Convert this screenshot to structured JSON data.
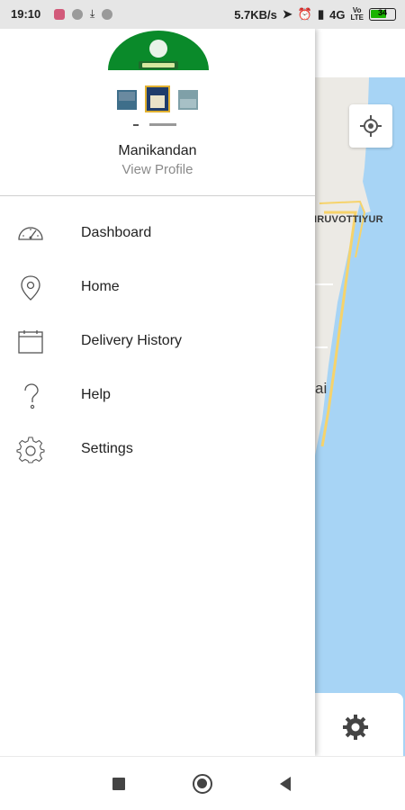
{
  "status_bar": {
    "time": "19:10",
    "network_speed": "5.7KB/s",
    "network_type": "4G",
    "lte_top": "Vo",
    "lte_bottom": "LTE",
    "battery": "34"
  },
  "drawer": {
    "user_name": "Manikandan",
    "view_profile": "View Profile",
    "menu": [
      {
        "label": "Dashboard",
        "icon": "speedometer-icon"
      },
      {
        "label": "Home",
        "icon": "location-pin-icon"
      },
      {
        "label": "Delivery History",
        "icon": "calendar-icon"
      },
      {
        "label": "Help",
        "icon": "question-icon"
      },
      {
        "label": "Settings",
        "icon": "gear-icon"
      }
    ]
  },
  "map": {
    "label_area": "IRUVOTTIYUR",
    "label_partial": "ai"
  },
  "colors": {
    "water": "#a7d4f5",
    "land": "#eceae5",
    "road": "#f6d36b",
    "logo_green": "#0a8a2a"
  }
}
